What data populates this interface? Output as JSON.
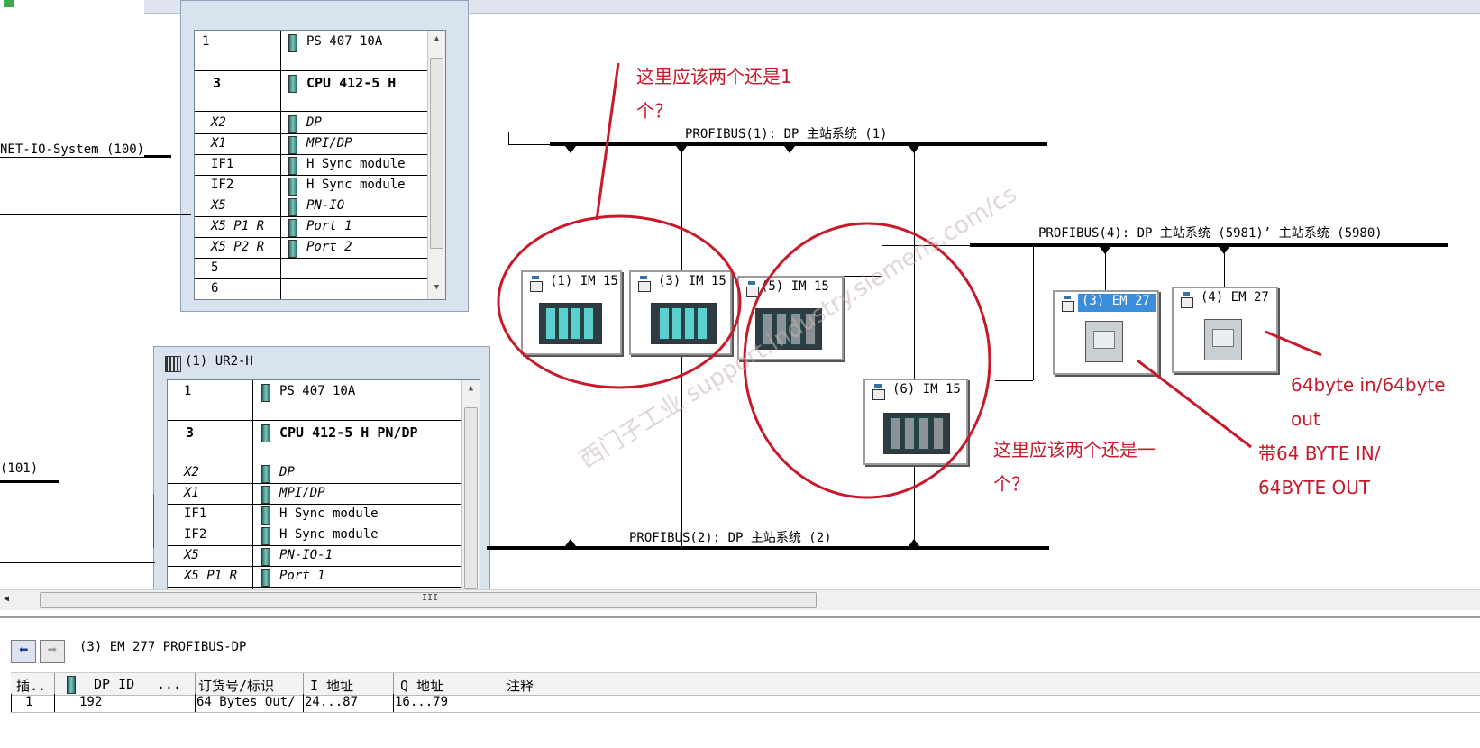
{
  "rack1": {
    "rows": [
      {
        "slot": "1",
        "module": "PS 407 10A",
        "style": "normal"
      },
      {
        "slot": "3",
        "module": "CPU 412-5 H",
        "style": "bold"
      },
      {
        "slot": "X2",
        "module": "DP",
        "style": "italic"
      },
      {
        "slot": "X1",
        "module": "MPI/DP",
        "style": "italic"
      },
      {
        "slot": "IF1",
        "module": "H Sync module",
        "style": "normal"
      },
      {
        "slot": "IF2",
        "module": "H Sync module",
        "style": "normal"
      },
      {
        "slot": "X5",
        "module": "PN-IO",
        "style": "italic"
      },
      {
        "slot": "X5 P1 R",
        "module": "Port 1",
        "style": "italic"
      },
      {
        "slot": "X5 P2 R",
        "module": "Port 2",
        "style": "italic"
      },
      {
        "slot": "5",
        "module": "",
        "style": "normal"
      },
      {
        "slot": "6",
        "module": "",
        "style": "normal"
      }
    ]
  },
  "rack2": {
    "title": "(1) UR2-H",
    "rows": [
      {
        "slot": "1",
        "module": "PS 407 10A",
        "style": "normal"
      },
      {
        "slot": "3",
        "module": "CPU 412-5 H PN/DP",
        "style": "bold"
      },
      {
        "slot": "X2",
        "module": "DP",
        "style": "italic"
      },
      {
        "slot": "X1",
        "module": "MPI/DP",
        "style": "italic"
      },
      {
        "slot": "IF1",
        "module": "H Sync module",
        "style": "normal"
      },
      {
        "slot": "IF2",
        "module": "H Sync module",
        "style": "normal"
      },
      {
        "slot": "X5",
        "module": "PN-IO-1",
        "style": "italic"
      },
      {
        "slot": "X5 P1 R",
        "module": "Port 1",
        "style": "italic"
      }
    ]
  },
  "network_labels": {
    "ethernet_1": "NET-IO-System (100)",
    "ethernet_2": "(101)",
    "profibus_1": "PROFIBUS(1): DP 主站系统 (1)",
    "profibus_2": "PROFIBUS(2): DP 主站系统 (2)",
    "profibus_4": "PROFIBUS(4): DP 主站系统 (5981)’ 主站系统 (5980)"
  },
  "stations": {
    "s1": "(1) IM 15",
    "s3": "(3) IM 15",
    "s5": "(5) IM 15",
    "s6": "(6) IM 15",
    "em3": "(3) EM 27",
    "em4": "(4) EM 27"
  },
  "annotations": {
    "note1_line1": "这里应该两个还是1",
    "note1_line2": "个？",
    "note2_line1": "这里应该两个还是一",
    "note2_line2": "个？",
    "note3_line1": "带64 BYTE IN/",
    "note3_line2": "64BYTE OUT",
    "note4_line1": "64byte in/64byte",
    "note4_line2": "out"
  },
  "watermark": "西门子工业 support.industry.siemens.com/cs",
  "detail": {
    "title": "(3)   EM 277 PROFIBUS-DP",
    "columns": [
      "插..",
      "DP ID",
      "...",
      "订货号/标识",
      "I 地址",
      "Q 地址",
      "注释"
    ],
    "row": {
      "slot": "1",
      "dp_id": "192",
      "order": "64 Bytes Out/",
      "i_addr": "24...87",
      "q_addr": "16...79",
      "comment": ""
    }
  },
  "colors": {
    "annotation": "#c8192a",
    "selection": "#3a8ddb",
    "rack_frame": "#d9e3ee"
  },
  "icons": [
    "back-arrow-icon",
    "forward-arrow-icon",
    "slave-station-icon",
    "module-icon",
    "rack-icon"
  ]
}
